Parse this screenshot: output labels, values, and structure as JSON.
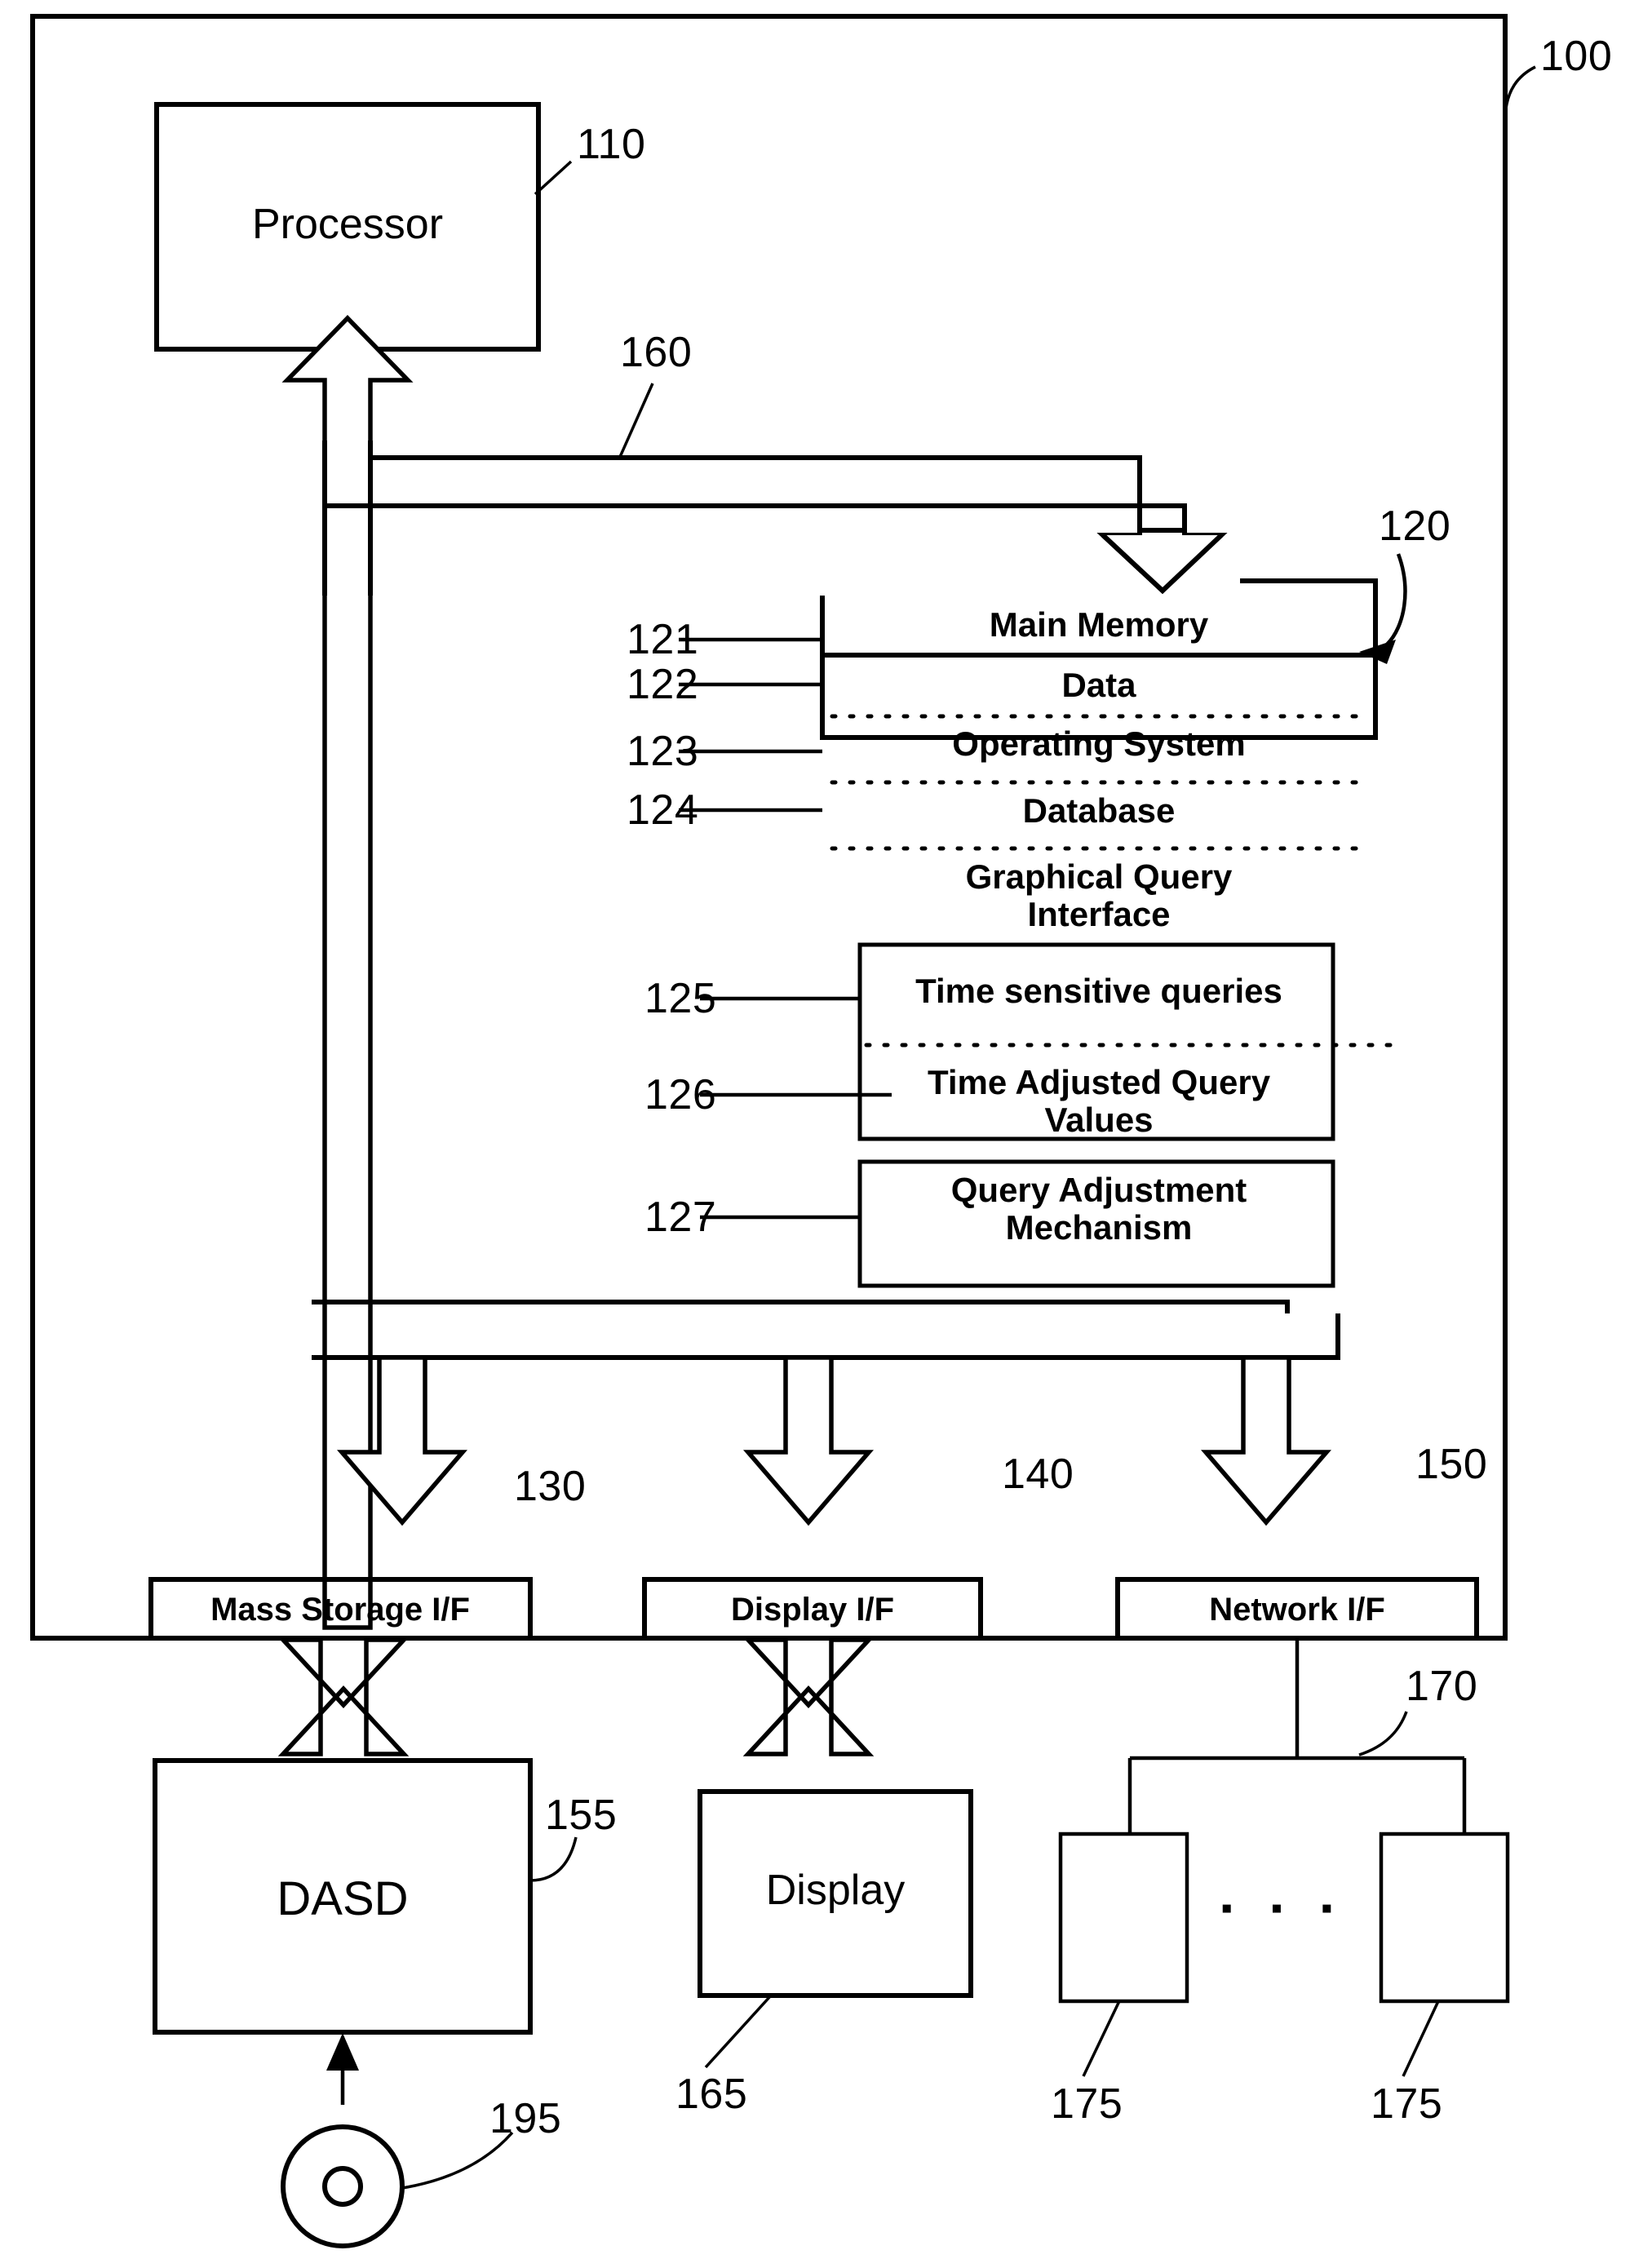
{
  "figure": {
    "type": "patent-block-diagram",
    "system_numeral": "100"
  },
  "blocks": {
    "processor": {
      "label": "Processor",
      "numeral": "110"
    },
    "main_memory": {
      "title": "Main Memory",
      "numeral": "120",
      "segments": [
        {
          "label": "Data",
          "numeral": "121"
        },
        {
          "label": "Operating System",
          "numeral": "122"
        },
        {
          "label": "Database",
          "numeral": "123"
        },
        {
          "label": "Graphical Query Interface",
          "numeral": "124"
        }
      ],
      "nested_group_1": [
        {
          "label": "Time sensitive queries",
          "numeral": "125"
        },
        {
          "label": "Time Adjusted Query Values",
          "numeral": "126"
        }
      ],
      "nested_group_2": [
        {
          "label": "Query Adjustment Mechanism",
          "numeral": "127"
        }
      ]
    },
    "bus": {
      "numeral": "160"
    },
    "mass_storage_if": {
      "label": "Mass Storage I/F",
      "numeral": "130"
    },
    "display_if": {
      "label": "Display I/F",
      "numeral": "140"
    },
    "network_if": {
      "label": "Network I/F",
      "numeral": "150"
    },
    "dasd": {
      "label": "DASD",
      "numeral": "155"
    },
    "display": {
      "label": "Display",
      "numeral": "165"
    },
    "network": {
      "numeral": "170"
    },
    "network_nodes": [
      {
        "numeral": "175"
      },
      {
        "numeral": "175"
      }
    ],
    "removable_media": {
      "numeral": "195"
    }
  },
  "text": {
    "graphical_query_line1": "Graphical Query",
    "graphical_query_line2": "Interface",
    "time_adjusted_line1": "Time Adjusted Query",
    "time_adjusted_line2": "Values",
    "query_adjust_line1": "Query Adjustment",
    "query_adjust_line2": "Mechanism",
    "ellipsis": "▪ ▪ ▪"
  },
  "colors": {
    "ink": "#000000",
    "paper": "#ffffff"
  }
}
